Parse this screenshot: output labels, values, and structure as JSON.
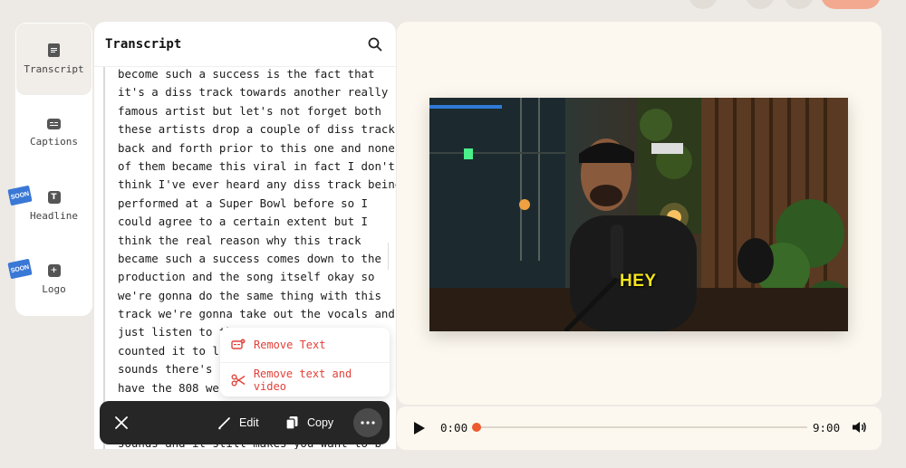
{
  "rail": {
    "items": [
      {
        "label": "Transcript",
        "icon": "document-icon",
        "active": true
      },
      {
        "label": "Captions",
        "icon": "captions-icon",
        "active": false
      },
      {
        "label": "Headline",
        "icon": "text-t-icon",
        "badge": "SOON",
        "active": false
      },
      {
        "label": "Logo",
        "icon": "plus-square-icon",
        "badge": "SOON",
        "active": false
      }
    ]
  },
  "transcript": {
    "title": "Transcript",
    "lines": [
      "become such a success is the fact that",
      "it's a diss track towards another really",
      "famous artist but let's not forget both",
      "these artists drop a couple of diss tracks",
      "back and forth prior to this one and none",
      "of them became this viral in fact I don't",
      "think I've ever heard any diss track being",
      "performed at a Super Bowl before so I",
      "could agree to a certain extent but I",
      "think the real reason why this track",
      "became such a success comes down to the",
      "production and the song itself okay so",
      "we're gonna do the same thing with this",
      "track we're gonna take out the vocals and",
      "just listen to th",
      "counted it to lik",
      "sounds there's no",
      "have the 808 we h"
    ],
    "peek_line": "sounds and it still makes you want to bang"
  },
  "menu": {
    "remove_text": "Remove Text",
    "remove_text_video": "Remove text and video"
  },
  "actionbar": {
    "edit": "Edit",
    "copy": "Copy"
  },
  "video": {
    "caption": "HEY"
  },
  "player": {
    "current_time": "0:00",
    "duration": "9:00",
    "progress": 0
  },
  "colors": {
    "accent": "#ee5a2f",
    "danger": "#e2413a",
    "badge": "#3a78d6"
  }
}
